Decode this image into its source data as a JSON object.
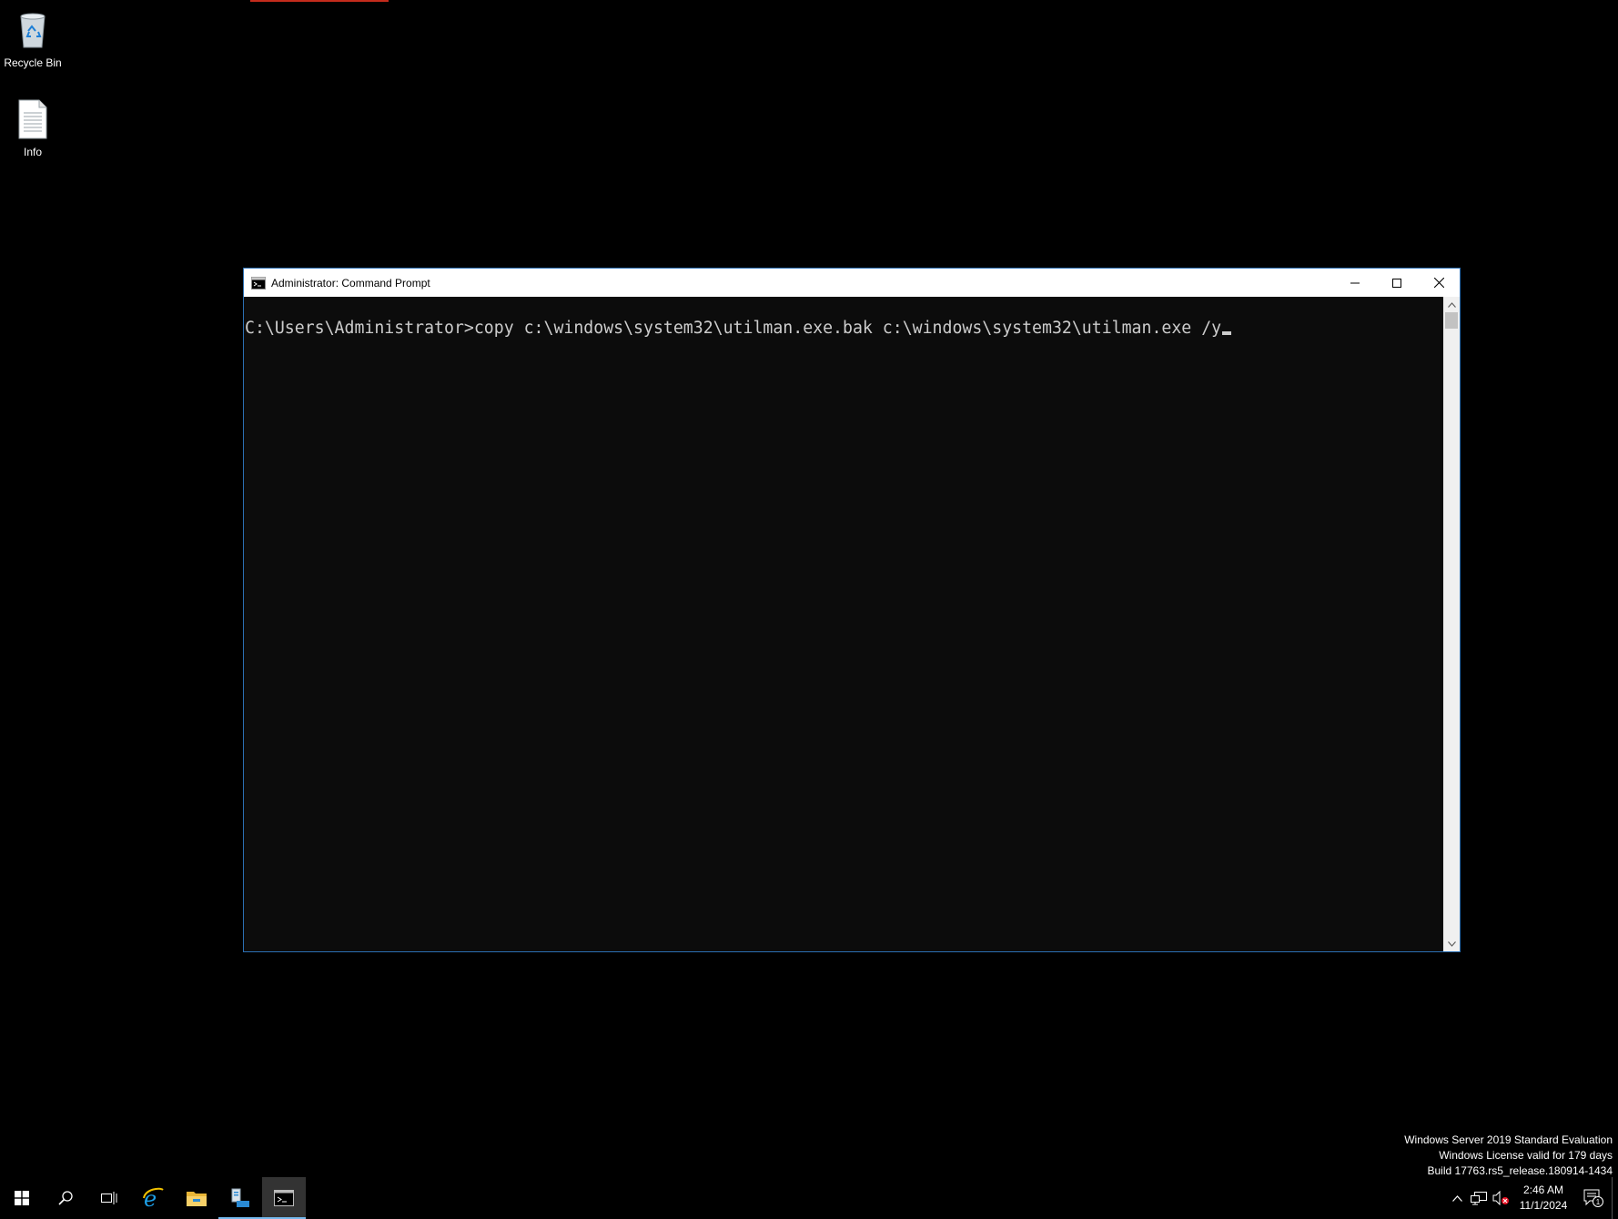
{
  "desktop": {
    "icons": [
      {
        "label": "Recycle Bin",
        "icon": "recycle-bin-icon"
      },
      {
        "label": "Info",
        "icon": "text-document-icon"
      }
    ]
  },
  "window": {
    "title": "Administrator: Command Prompt",
    "console": {
      "prompt": "C:\\Users\\Administrator>",
      "command": "copy c:\\windows\\system32\\utilman.exe.bak c:\\windows\\system32\\utilman.exe /y"
    }
  },
  "watermark": {
    "line1": "Windows Server 2019 Standard Evaluation",
    "line2": "Windows License valid for 179 days",
    "line3": "Build 17763.rs5_release.180914-1434"
  },
  "taskbar": {
    "apps": [
      {
        "icon": "start-windows-icon"
      },
      {
        "icon": "search-icon"
      },
      {
        "icon": "task-view-icon"
      },
      {
        "icon": "internet-explorer-icon"
      },
      {
        "icon": "file-explorer-icon"
      },
      {
        "icon": "server-manager-icon"
      },
      {
        "icon": "command-prompt-icon"
      }
    ],
    "clock": {
      "time": "2:46 AM",
      "date": "11/1/2024"
    },
    "notifications_count": "1"
  },
  "colors": {
    "console_bg": "#0c0c0c",
    "console_text": "#cccccc",
    "window_border": "#2b6fb3",
    "taskbar_active": "#76b9ed"
  }
}
